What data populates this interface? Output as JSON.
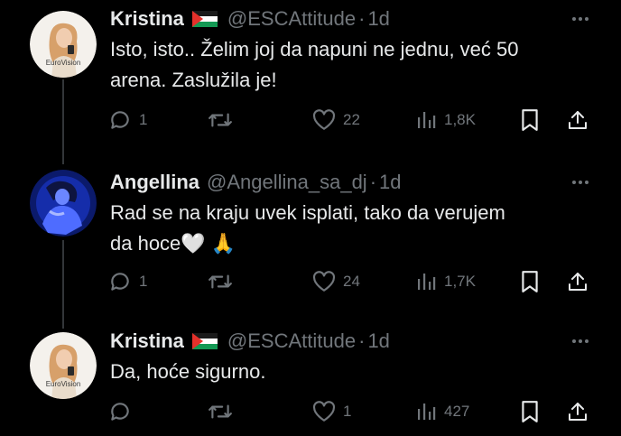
{
  "tweets": [
    {
      "name": "Kristina",
      "handle": "@ESCAttitude",
      "separator": "·",
      "time": "1d",
      "text": "Isto, isto.. Želim joj da napuni ne jednu, već 50\narena. Zaslužila je!",
      "avatar_caption": "EuroVision",
      "replies": "1",
      "retweets": "",
      "likes": "22",
      "views": "1,8K"
    },
    {
      "name": "Angellina",
      "handle": "@Angellina_sa_dj",
      "separator": "·",
      "time": "1d",
      "text": "Rad se na kraju uvek isplati, tako da verujem\nda hoce🤍 🙏",
      "replies": "1",
      "retweets": "",
      "likes": "24",
      "views": "1,7K"
    },
    {
      "name": "Kristina",
      "handle": "@ESCAttitude",
      "separator": "·",
      "time": "1d",
      "text": "Da, hoće sigurno.",
      "avatar_caption": "EuroVision",
      "replies": "",
      "retweets": "",
      "likes": "1",
      "views": "427"
    }
  ],
  "icons": {
    "reply": "reply-icon",
    "retweet": "retweet-icon",
    "like": "heart-icon",
    "views": "views-icon",
    "bookmark": "bookmark-icon",
    "share": "share-icon",
    "more": "more-icon",
    "flag": "palestine-flag-icon"
  },
  "colors": {
    "background": "#000000",
    "text": "#e7e9ea",
    "secondary": "#71767b",
    "thread_line": "#333639"
  }
}
